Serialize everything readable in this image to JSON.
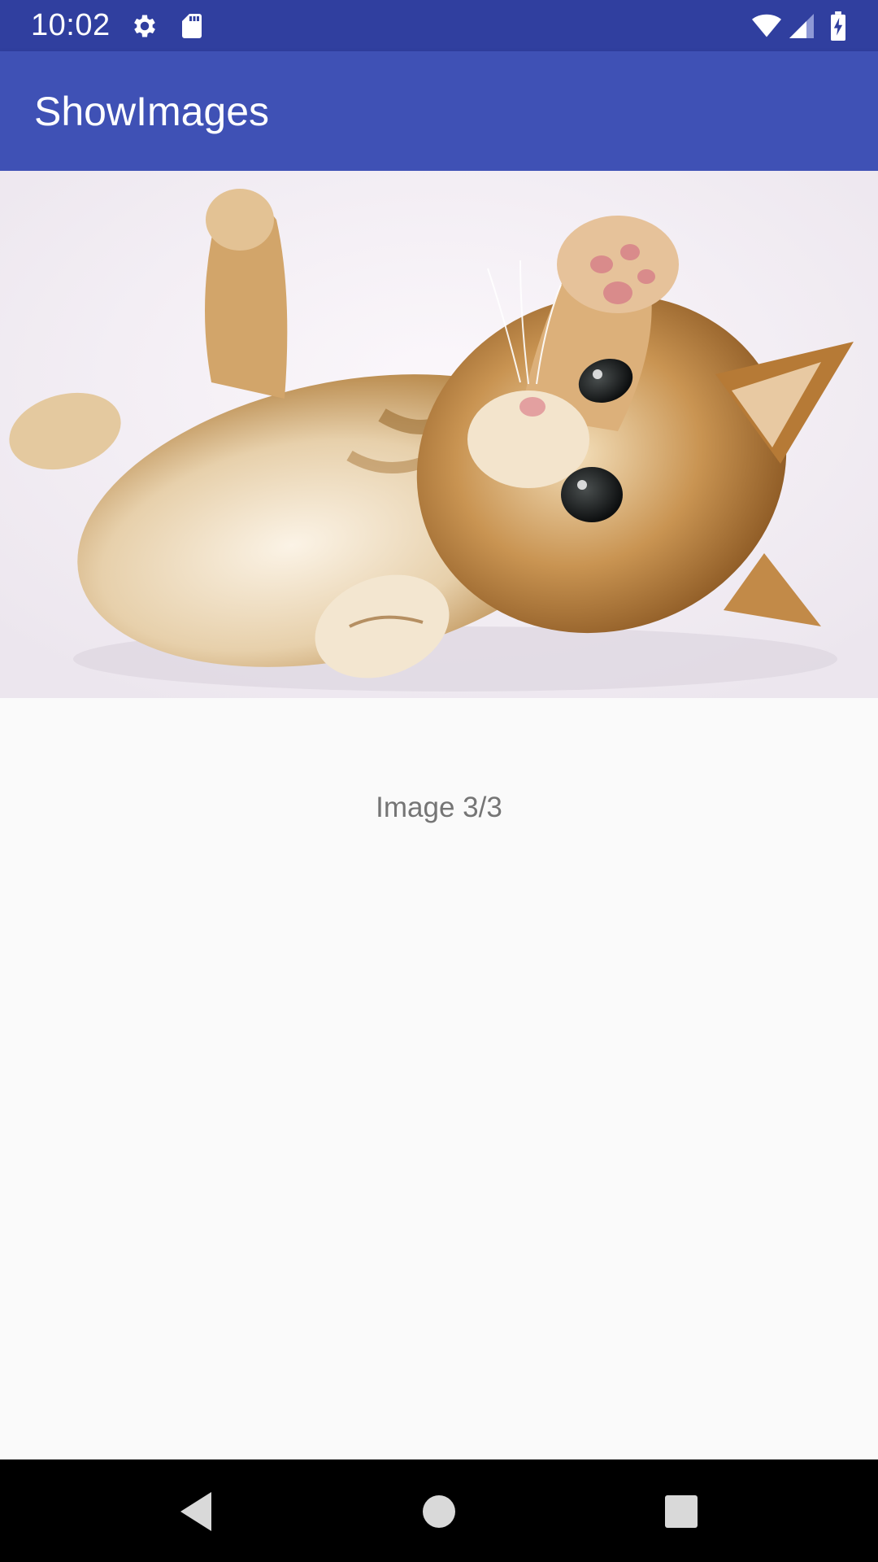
{
  "status_bar": {
    "time": "10:02",
    "icons_left": [
      "gear-icon",
      "sd-card-icon"
    ],
    "icons_right": [
      "wifi-icon",
      "cell-signal-icon",
      "battery-charging-icon"
    ],
    "background": "#303f9f"
  },
  "app_bar": {
    "title": "ShowImages",
    "background": "#3f51b5"
  },
  "image": {
    "subject": "kitten-photo"
  },
  "caption": {
    "text": "Image 3/3"
  },
  "nav_bar": {
    "buttons": [
      "back-icon",
      "home-icon",
      "recents-icon"
    ],
    "background": "#000000"
  }
}
